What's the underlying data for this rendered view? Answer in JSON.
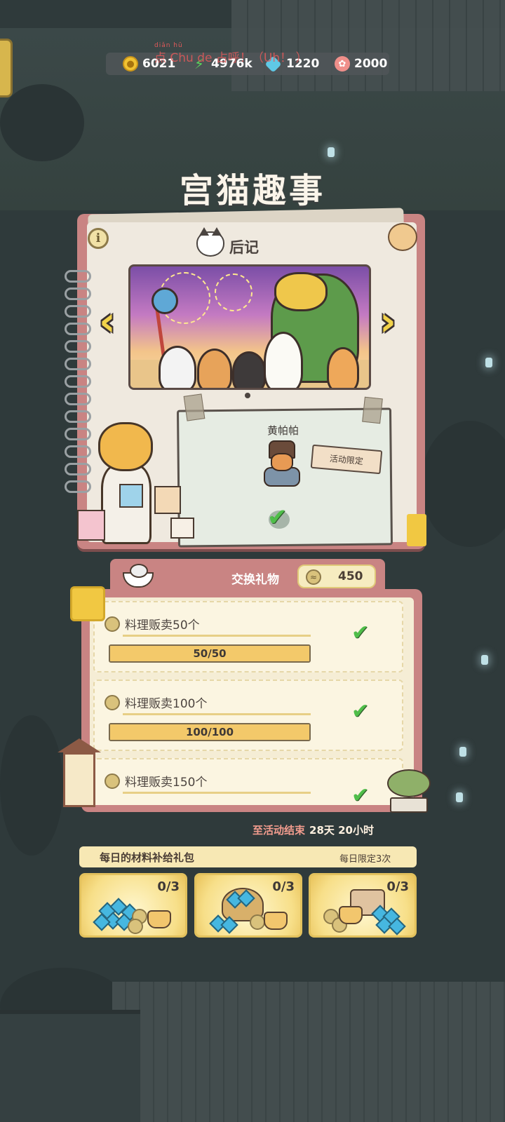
{
  "resources": [
    {
      "icon": "coin-icon",
      "value": "6021"
    },
    {
      "icon": "energy-bolt-icon",
      "value": "4976k"
    },
    {
      "icon": "gem-icon",
      "value": "1220"
    },
    {
      "icon": "fish-token-icon",
      "value": "2000"
    }
  ],
  "overlay": {
    "pinyin": "diǎn hū",
    "text": "点 Chu de 占呼！（Uh！ ）"
  },
  "title": "宫猫趣事",
  "story": {
    "section_label": "后记",
    "character_name": "黄帕帕",
    "limited_tag": "活动限定"
  },
  "exchange": {
    "label": "交换礼物",
    "cost": "450"
  },
  "tasks": [
    {
      "name": "料理贩卖50个",
      "progress_text": "50/50",
      "progress": 1.0
    },
    {
      "name": "料理贩卖100个",
      "progress_text": "100/100",
      "progress": 1.0
    },
    {
      "name": "料理贩卖150个",
      "progress_text": "",
      "progress": 1.0
    }
  ],
  "countdown": {
    "label": "至活动结束",
    "remaining": "28天 20小时"
  },
  "daily": {
    "title": "每日的材料补给礼包",
    "limit": "每日限定3次",
    "packs": [
      {
        "count": "0/3"
      },
      {
        "count": "0/3"
      },
      {
        "count": "0/3"
      }
    ]
  },
  "colors": {
    "accent_red": "#c98483",
    "gold": "#f1c842",
    "check_green": "#4fbe49"
  }
}
